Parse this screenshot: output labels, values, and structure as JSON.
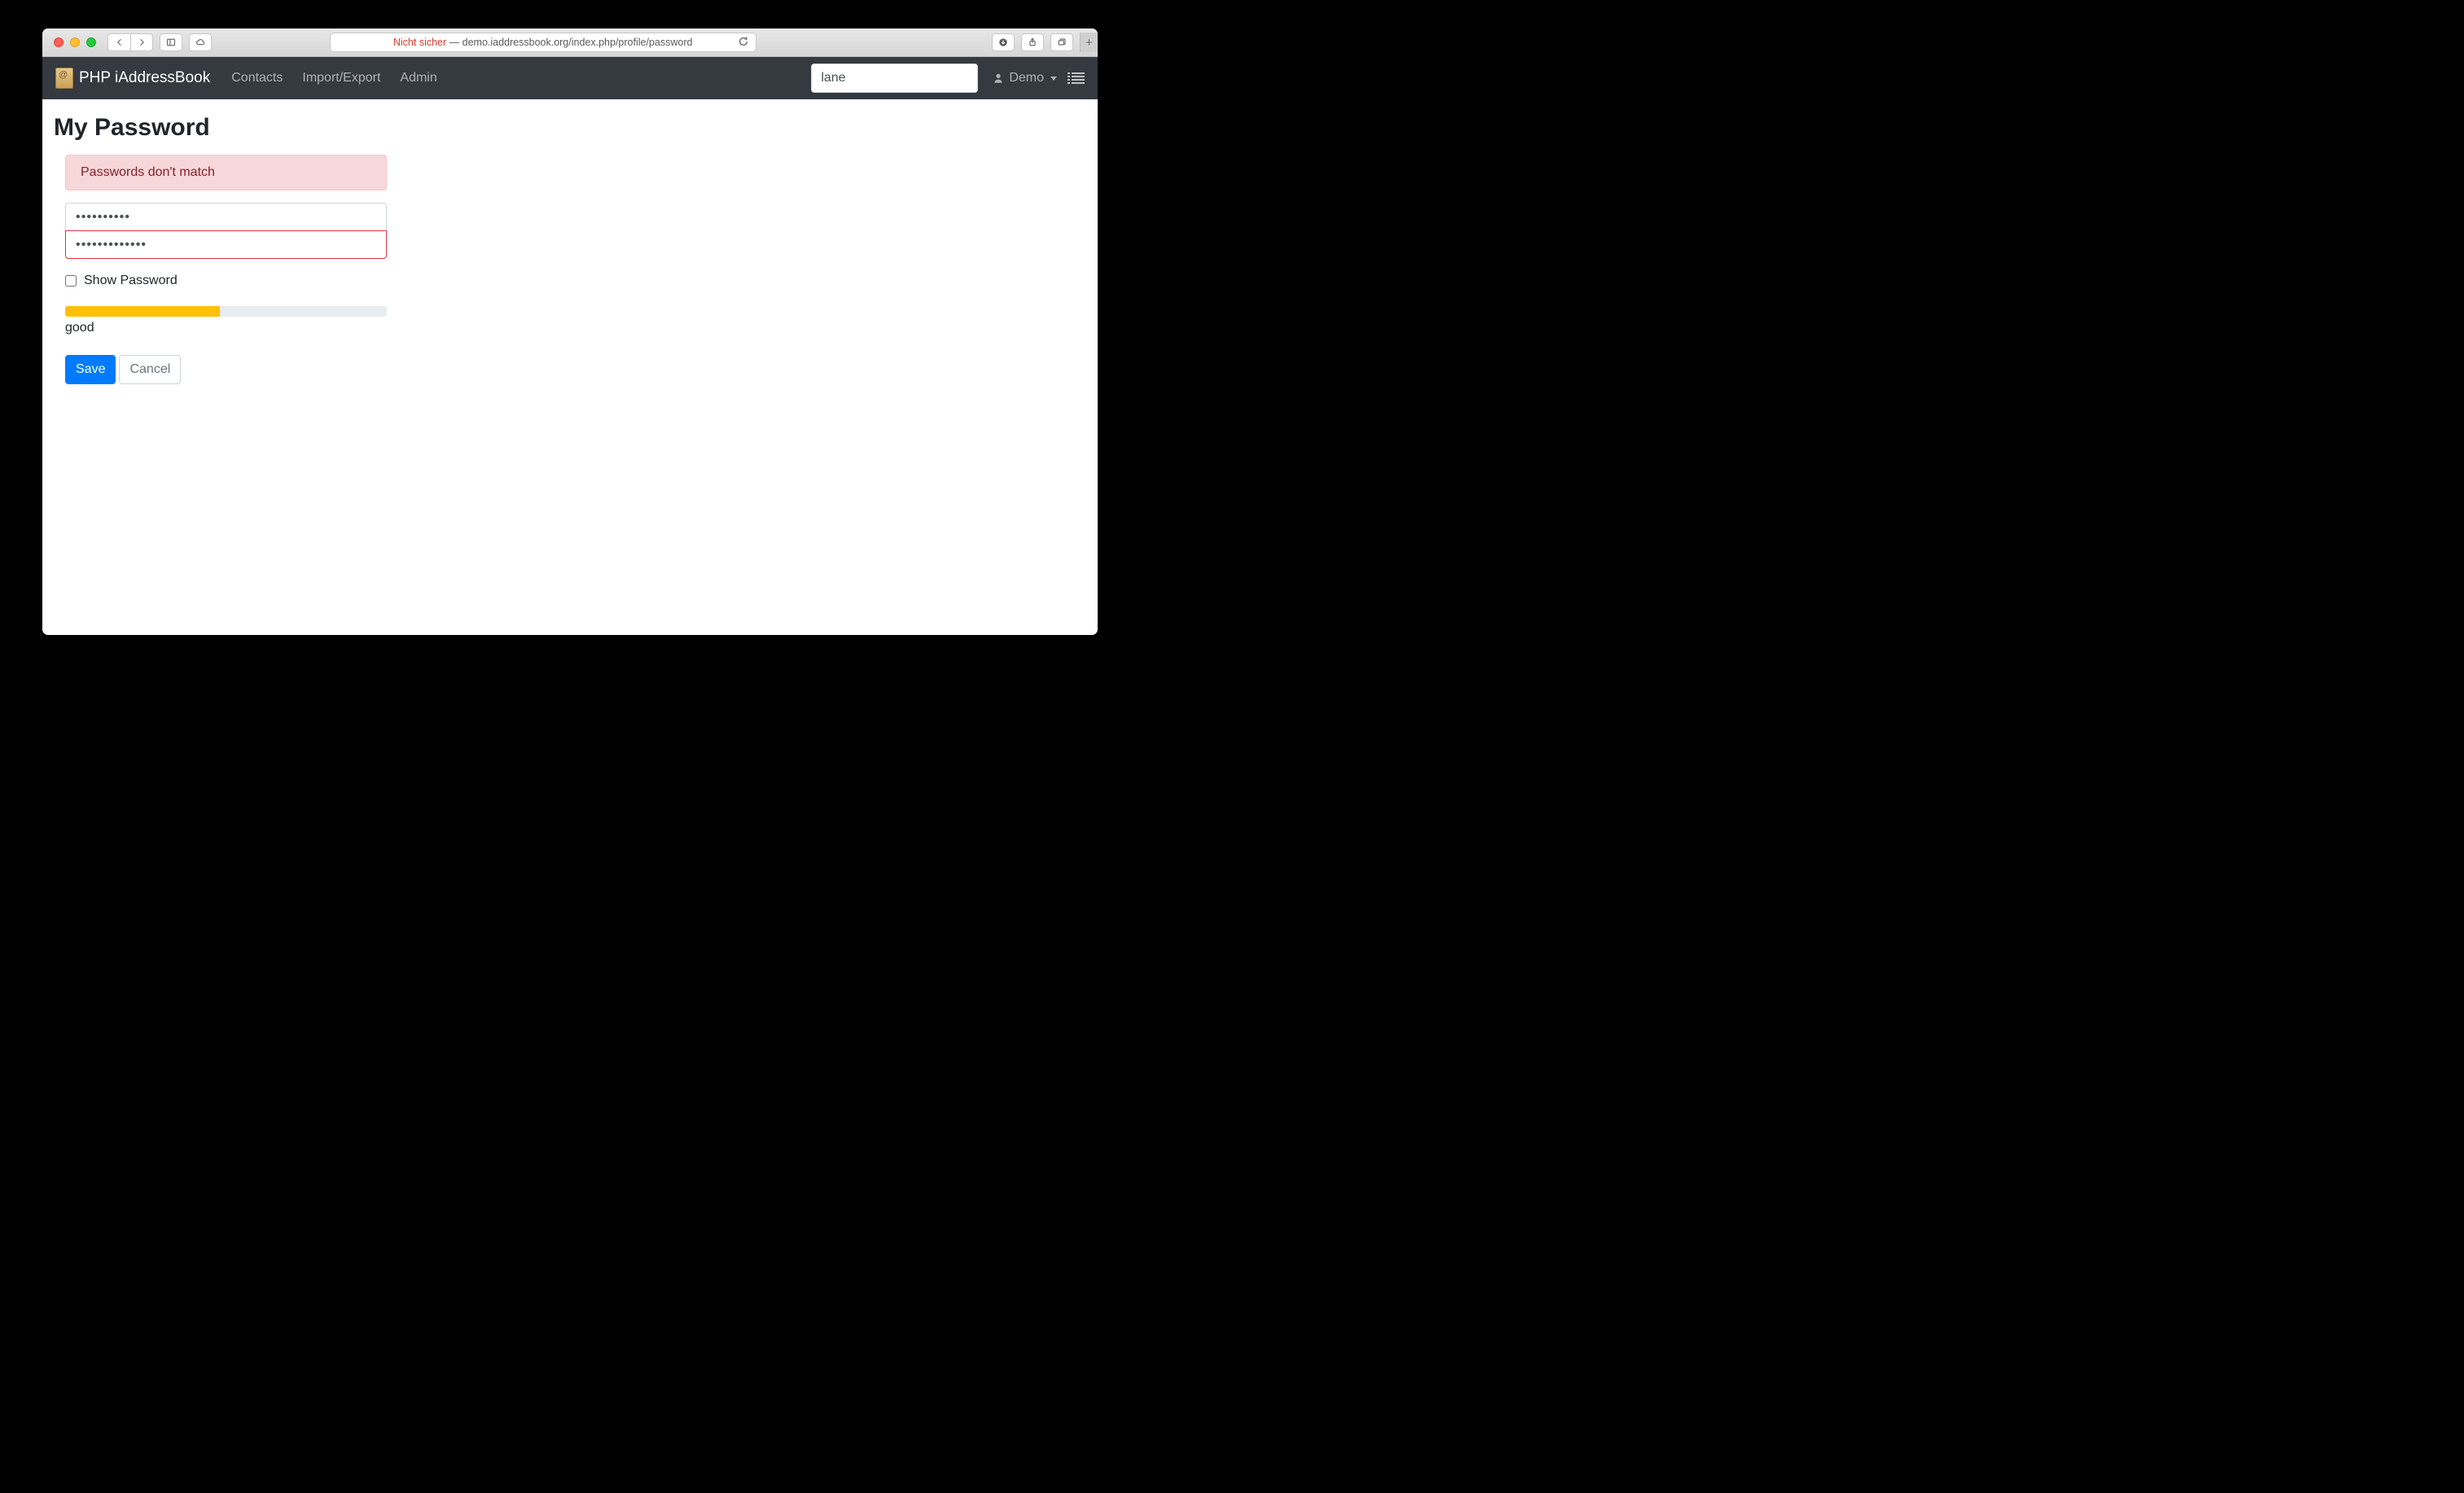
{
  "browser": {
    "insecure_label": "Nicht sicher",
    "url_separator": " — ",
    "url": "demo.iaddressbook.org/index.php/profile/password"
  },
  "navbar": {
    "brand": "PHP iAddressBook",
    "links": [
      "Contacts",
      "Import/Export",
      "Admin"
    ],
    "search_value": "lane",
    "user_label": "Demo"
  },
  "page": {
    "title": "My Password",
    "alert": "Passwords don't match",
    "password1": "••••••••••",
    "password2": "•••••••••••••",
    "show_password_label": "Show Password",
    "strength_percent": 48,
    "strength_label": "good",
    "save_label": "Save",
    "cancel_label": "Cancel"
  }
}
